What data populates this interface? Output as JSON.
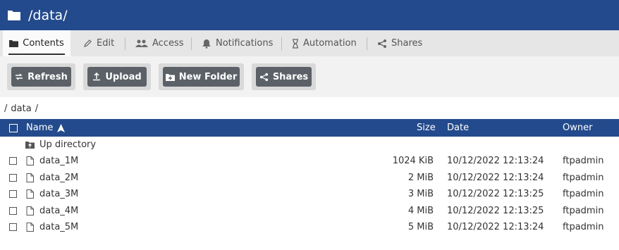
{
  "header": {
    "title": "/data/",
    "icon": "folder-icon"
  },
  "tabs": [
    {
      "label": "Contents",
      "icon": "folder-icon",
      "active": true
    },
    {
      "label": "Edit",
      "icon": "pencil-icon"
    },
    {
      "label": "Access",
      "icon": "users-icon"
    },
    {
      "label": "Notifications",
      "icon": "bell-icon"
    },
    {
      "label": "Automation",
      "icon": "hourglass-icon"
    },
    {
      "label": "Shares",
      "icon": "share-icon"
    }
  ],
  "toolbar": {
    "refresh": "Refresh",
    "upload": "Upload",
    "new_folder": "New Folder",
    "shares": "Shares"
  },
  "breadcrumb": {
    "sep1": "/",
    "part": "data",
    "sep2": "/"
  },
  "table": {
    "columns": {
      "name": "Name",
      "size": "Size",
      "date": "Date",
      "owner": "Owner"
    },
    "sort": {
      "column": "name",
      "direction": "ascending"
    },
    "up_directory": "Up directory",
    "rows": [
      {
        "name": "data_1M",
        "size": "1024 KiB",
        "date": "10/12/2022 12:13:24",
        "owner": "ftpadmin"
      },
      {
        "name": "data_2M",
        "size": "2 MiB",
        "date": "10/12/2022 12:13:24",
        "owner": "ftpadmin"
      },
      {
        "name": "data_3M",
        "size": "3 MiB",
        "date": "10/12/2022 12:13:25",
        "owner": "ftpadmin"
      },
      {
        "name": "data_4M",
        "size": "4 MiB",
        "date": "10/12/2022 12:13:25",
        "owner": "ftpadmin"
      },
      {
        "name": "data_5M",
        "size": "5 MiB",
        "date": "10/12/2022 12:13:24",
        "owner": "ftpadmin"
      }
    ]
  },
  "colors": {
    "primary": "#234a8c",
    "button": "#5b6167",
    "tabbar": "#e6e6e6"
  }
}
